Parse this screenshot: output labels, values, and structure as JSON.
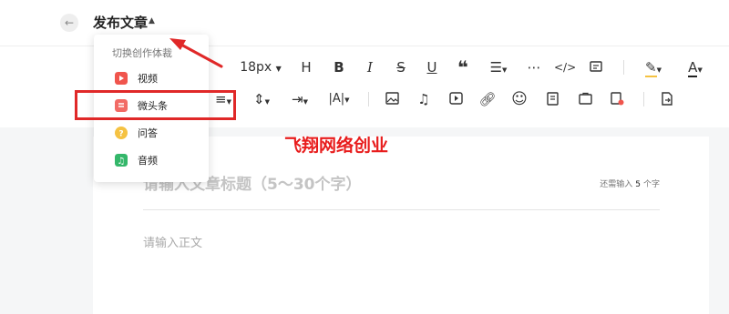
{
  "header": {
    "title": "发布文章"
  },
  "toolbar": {
    "font_size": "18px"
  },
  "dropdown": {
    "title": "切换创作体裁",
    "items": [
      {
        "label": "视频",
        "icon": "video-icon",
        "color": "#f0554d"
      },
      {
        "label": "微头条",
        "icon": "micro-headline-icon",
        "color": "#f26b65"
      },
      {
        "label": "问答",
        "icon": "qa-icon",
        "color": "#f5c242"
      },
      {
        "label": "音频",
        "icon": "audio-icon",
        "color": "#34b76a"
      }
    ]
  },
  "editor": {
    "title_placeholder": "请输入文章标题（5～30个字）",
    "counter": {
      "prefix": "还需输入",
      "count": "5",
      "suffix": "个字"
    },
    "body_placeholder": "请输入正文"
  },
  "watermark": "飞翔网络创业",
  "colors": {
    "highlight": "#e02828",
    "watermark": "#e81c1c"
  }
}
